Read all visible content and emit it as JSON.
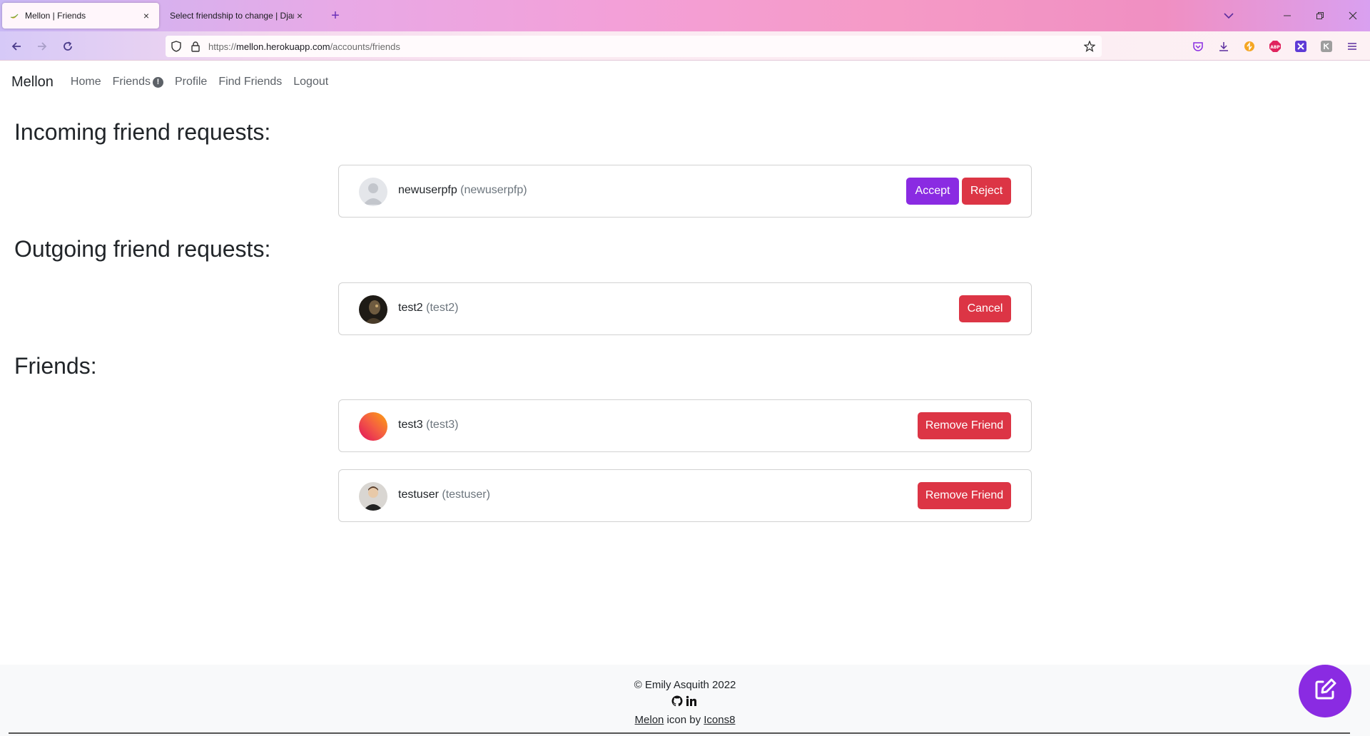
{
  "browser": {
    "tabs": [
      {
        "title": "Mellon | Friends",
        "active": true
      },
      {
        "title": "Select friendship to change | Django",
        "active": false
      }
    ],
    "url_prefix": "https://",
    "url_host": "mellon.herokuapp.com",
    "url_path": "/accounts/friends",
    "new_tab_symbol": "+",
    "close_symbol": "×"
  },
  "site_nav": {
    "brand": "Mellon",
    "links": [
      "Home",
      "Friends",
      "Profile",
      "Find Friends",
      "Logout"
    ],
    "friends_badge": "!"
  },
  "incoming": {
    "heading": "Incoming friend requests:",
    "items": [
      {
        "name": "newuserpfp",
        "handle": "(newuserpfp)",
        "accept": "Accept",
        "reject": "Reject"
      }
    ]
  },
  "outgoing": {
    "heading": "Outgoing friend requests:",
    "items": [
      {
        "name": "test2",
        "handle": "(test2)",
        "cancel": "Cancel"
      }
    ]
  },
  "friends": {
    "heading": "Friends:",
    "items": [
      {
        "name": "test3",
        "handle": "(test3)",
        "remove": "Remove Friend"
      },
      {
        "name": "testuser",
        "handle": "(testuser)",
        "remove": "Remove Friend"
      }
    ]
  },
  "footer": {
    "copyright": "© Emily Asquith 2022",
    "credit_link1": "Melon",
    "credit_mid": " icon by ",
    "credit_link2": "Icons8"
  },
  "colors": {
    "accent_purple": "#8a2be2",
    "danger_red": "#dc3545"
  }
}
